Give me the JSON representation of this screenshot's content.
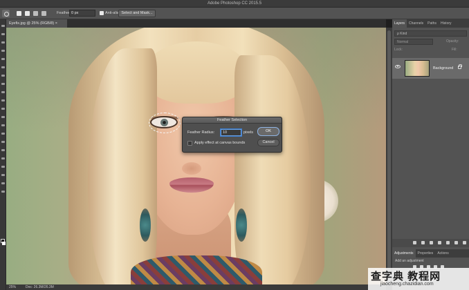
{
  "window": {
    "title": "Adobe Photoshop CC 2015.5"
  },
  "options_bar": {
    "feather_label": "Feather:",
    "feather_value": "0 px",
    "anti_alias_label": "Anti-alias",
    "select_and_mask_label": "Select and Mask..."
  },
  "document": {
    "tab_label": "Eyefix.jpg @ 25% (RGB/8) ×"
  },
  "dialog": {
    "title": "Feather Selection",
    "radius_label": "Feather Radius:",
    "radius_value": "10",
    "unit": "pixels",
    "ok_label": "OK",
    "cancel_label": "Cancel",
    "checkbox_label": "Apply effect at canvas bounds",
    "checkbox_checked": false
  },
  "status_bar": {
    "zoom": "25%",
    "doc_size": "Doc: 26.3M/26.3M"
  },
  "layers_panel": {
    "tabs": [
      "Layers",
      "Channels",
      "Paths",
      "History"
    ],
    "active_tab": "Layers",
    "kind_filter": "ρ Kind",
    "blend_mode": "Normal",
    "opacity_label": "Opacity:",
    "fill_label": "Fill:",
    "lock_label": "Lock:",
    "layer": {
      "name": "Background",
      "visible": true,
      "locked": true
    }
  },
  "adjustments_panel": {
    "tabs": [
      "Adjustments",
      "Properties",
      "Actions"
    ],
    "active_tab": "Adjustments",
    "hint": "Add an adjustment"
  },
  "watermark": {
    "main": "查字典 教程网",
    "sub": "jiaocheng.chazidian.com"
  },
  "colors": {
    "panel_bg": "#535353",
    "dark_bg": "#1e1e1e",
    "focus_blue": "#3a78c8",
    "foreground_swatch": "#111111",
    "background_swatch": "#ffffff"
  }
}
